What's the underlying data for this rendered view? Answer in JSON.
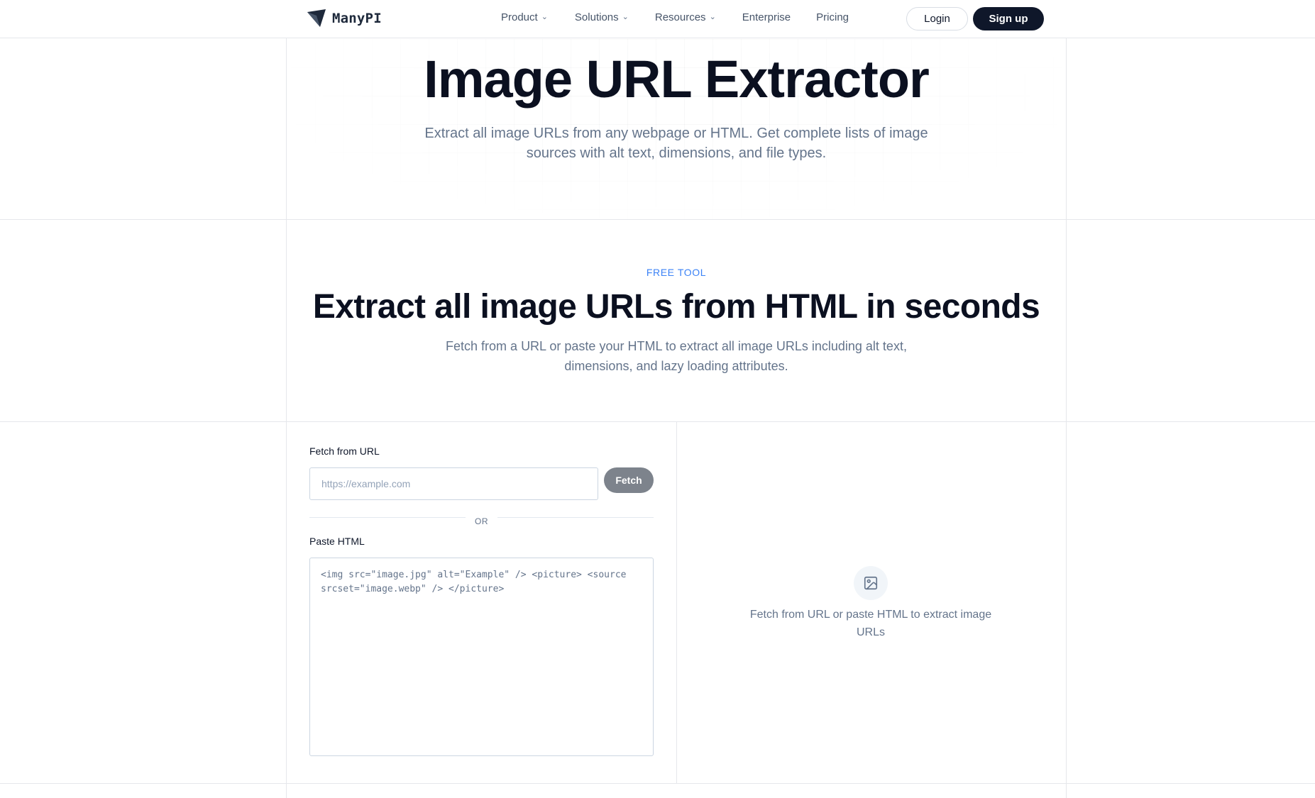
{
  "brand": {
    "name": "ManyPI"
  },
  "nav": {
    "items": [
      {
        "label": "Product",
        "has_dropdown": true
      },
      {
        "label": "Solutions",
        "has_dropdown": true
      },
      {
        "label": "Resources",
        "has_dropdown": true
      },
      {
        "label": "Enterprise",
        "has_dropdown": false
      },
      {
        "label": "Pricing",
        "has_dropdown": false
      }
    ],
    "login_label": "Login",
    "signup_label": "Sign up"
  },
  "hero": {
    "title": "Image URL Extractor",
    "subtitle": "Extract all image URLs from any webpage or HTML. Get complete lists of image sources with alt text, dimensions, and file types."
  },
  "section": {
    "eyebrow": "FREE TOOL",
    "title": "Extract all image URLs from HTML in seconds",
    "subtitle": "Fetch from a URL or paste your HTML to extract all image URLs including alt text, dimensions, and lazy loading attributes."
  },
  "tool": {
    "url_label": "Fetch from URL",
    "url_placeholder": "https://example.com",
    "fetch_label": "Fetch",
    "or_label": "OR",
    "html_label": "Paste HTML",
    "html_placeholder": "<img src=\"image.jpg\" alt=\"Example\" /> <picture> <source srcset=\"image.webp\" /> </picture>",
    "empty_state": "Fetch from URL or paste HTML to extract image URLs",
    "empty_icon": "image-icon"
  },
  "colors": {
    "primary": "#0f172a",
    "accent": "#3b82f6",
    "muted_text": "#64748b",
    "fetch_disabled": "#7d838c",
    "border": "#e5e7eb"
  }
}
